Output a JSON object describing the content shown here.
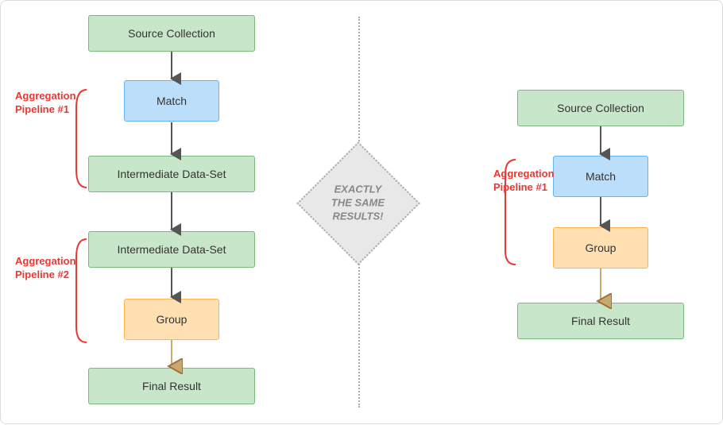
{
  "left": {
    "source_collection": "Source Collection",
    "match": "Match",
    "intermediate1": "Intermediate Data-Set",
    "intermediate2": "Intermediate Data-Set",
    "group": "Group",
    "final": "Final Result",
    "pipeline1_label": "Aggregation\nPipeline #1",
    "pipeline2_label": "Aggregation\nPipeline #2"
  },
  "center": {
    "diamond_text": "EXACTLY\nTHE SAME\nRESULTS!"
  },
  "right": {
    "source_collection": "Source Collection",
    "match": "Match",
    "group": "Group",
    "final": "Final Result",
    "pipeline1_label": "Aggregation\nPipeline #1"
  }
}
